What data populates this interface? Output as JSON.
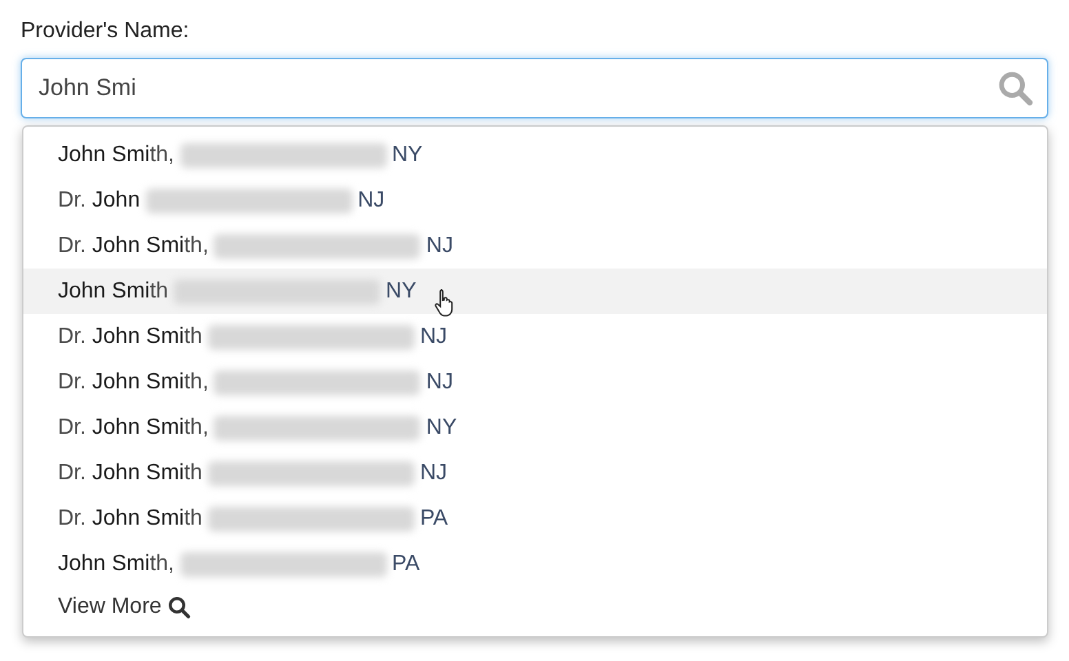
{
  "label": "Provider's Name:",
  "search": {
    "value": "John Smi"
  },
  "results": [
    {
      "name": "**John Smi**th,",
      "state": "NY",
      "selected": false
    },
    {
      "name": "Dr. **John**",
      "state": "NJ",
      "selected": false
    },
    {
      "name": "Dr. **John Smi**th,",
      "state": "NJ",
      "selected": false
    },
    {
      "name": "**John Smi**th",
      "state": "NY",
      "selected": true
    },
    {
      "name": "Dr. **John Smi**th",
      "state": "NJ",
      "selected": false
    },
    {
      "name": "Dr. **John Smi**th,",
      "state": "NJ",
      "selected": false
    },
    {
      "name": "Dr. **John Smi**th,",
      "state": "NY",
      "selected": false
    },
    {
      "name": "Dr. **John Smi**th",
      "state": "NJ",
      "selected": false
    },
    {
      "name": "Dr. **John Smi**th",
      "state": "PA",
      "selected": false
    },
    {
      "name": "**John Smi**th,",
      "state": "PA",
      "selected": false
    }
  ],
  "view_more": "View More"
}
